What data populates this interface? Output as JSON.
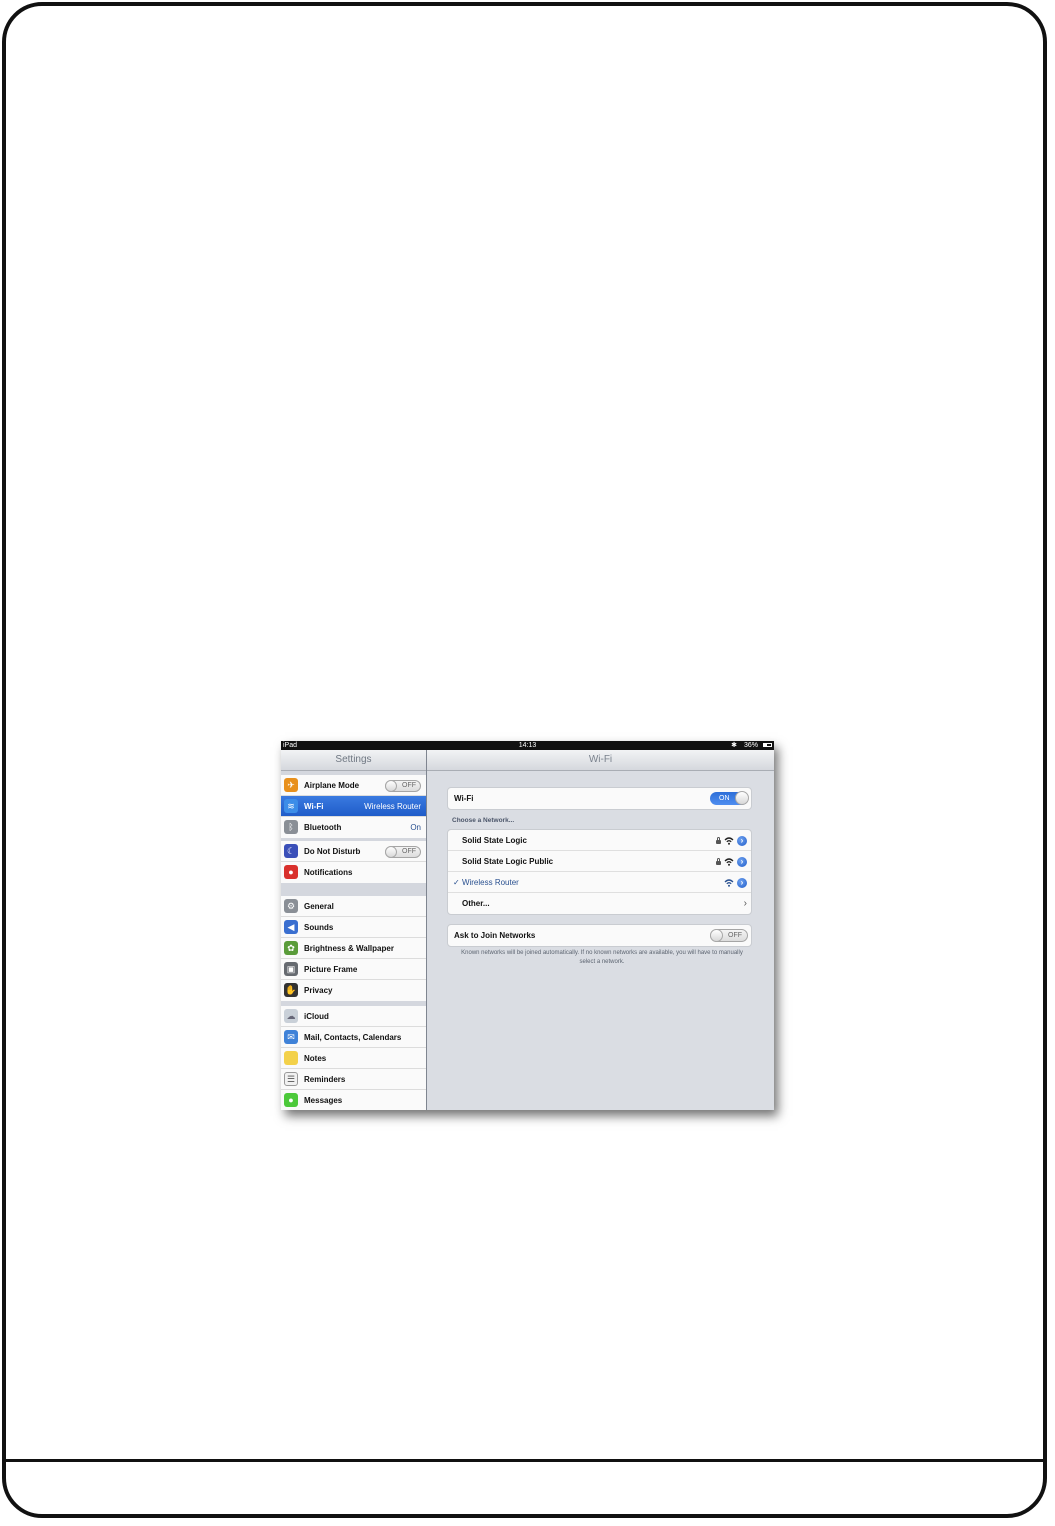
{
  "status_bar": {
    "carrier": "iPad",
    "time": "14:13",
    "battery": "36%"
  },
  "master": {
    "title": "Settings",
    "groups": [
      {
        "items": [
          {
            "label": "Airplane Mode",
            "switch": "OFF",
            "icon": "airplane-icon",
            "color": "#e8901c"
          },
          {
            "label": "Wi-Fi",
            "value": "Wireless Router",
            "selected": true,
            "icon": "wifi-icon",
            "color": "#3c8de8"
          },
          {
            "label": "Bluetooth",
            "value": "On",
            "icon": "bluetooth-icon",
            "color": "#8a8f96"
          }
        ]
      },
      {
        "items": [
          {
            "label": "Do Not Disturb",
            "switch": "OFF",
            "icon": "moon-icon",
            "color": "#3a4fb8"
          },
          {
            "label": "Notifications",
            "icon": "notifications-icon",
            "color": "#d9302c"
          }
        ]
      },
      {
        "items": [
          {
            "label": "General",
            "icon": "gear-icon",
            "color": "#8a8f96"
          },
          {
            "label": "Sounds",
            "icon": "speaker-icon",
            "color": "#3a6fd0"
          },
          {
            "label": "Brightness & Wallpaper",
            "icon": "brightness-icon",
            "color": "#5a9c3a"
          },
          {
            "label": "Picture Frame",
            "icon": "picture-frame-icon",
            "color": "#666a70"
          },
          {
            "label": "Privacy",
            "icon": "hand-icon",
            "color": "#333333"
          }
        ]
      },
      {
        "items": [
          {
            "label": "iCloud",
            "icon": "cloud-icon",
            "color": "#9aa4b0"
          },
          {
            "label": "Mail, Contacts, Calendars",
            "icon": "mail-icon",
            "color": "#3f82d8"
          },
          {
            "label": "Notes",
            "icon": "notes-icon",
            "color": "#f3d14a"
          },
          {
            "label": "Reminders",
            "icon": "reminders-icon",
            "color": "#f1f1f1"
          },
          {
            "label": "Messages",
            "icon": "messages-icon",
            "color": "#4cc93a"
          }
        ]
      }
    ]
  },
  "detail": {
    "title": "Wi-Fi",
    "wifi_row": {
      "label": "Wi-Fi",
      "switch": "ON"
    },
    "section_header": "Choose a Network...",
    "networks": [
      {
        "name": "Solid State Logic",
        "locked": true
      },
      {
        "name": "Solid State Logic Public",
        "locked": true
      },
      {
        "name": "Wireless Router",
        "locked": false,
        "connected": true,
        "check": "✓"
      }
    ],
    "other_row": "Other...",
    "ask_row": {
      "label": "Ask to Join Networks",
      "switch": "OFF"
    },
    "footnote": "Known networks will be joined automatically. If no known networks are available, you will have to manually select a network."
  }
}
